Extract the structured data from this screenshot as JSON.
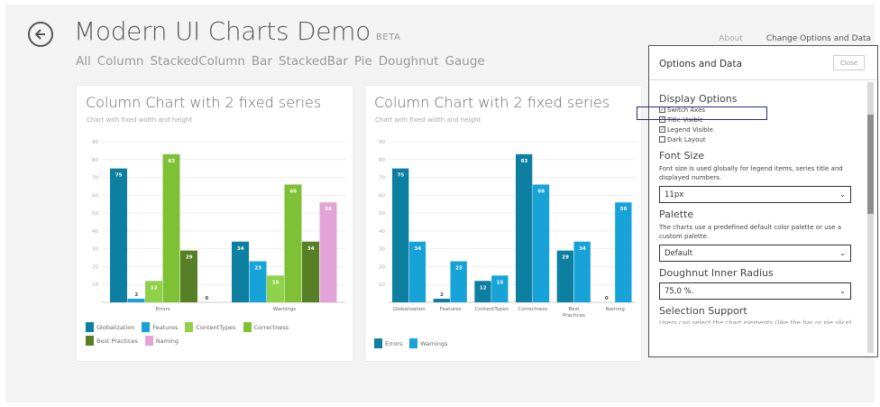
{
  "app": {
    "title": "Modern UI Charts Demo",
    "badge": "BETA",
    "nav": [
      "All",
      "Column",
      "StackedColumn",
      "Bar",
      "StackedBar",
      "Pie",
      "Doughnut",
      "Gauge"
    ],
    "top_links": {
      "about": "About",
      "options": "Change Options and Data"
    }
  },
  "colors": {
    "globalization": "#0d7fa1",
    "features": "#17a3d8",
    "content_types": "#8fd24a",
    "correctness": "#7fc135",
    "best_practices": "#577f25",
    "naming": "#e2a4d6",
    "errors": "#0d7fa1",
    "warnings": "#17a3d8"
  },
  "chart_data": [
    {
      "type": "bar",
      "title": "Column Chart with 2 fixed series",
      "subtitle": "Chart with fixed width and height",
      "categories": [
        "Errors",
        "Warnings"
      ],
      "ylim": [
        0,
        90
      ],
      "yticks": [
        10,
        20,
        30,
        40,
        50,
        60,
        70,
        80,
        90
      ],
      "series": [
        {
          "name": "Globalization",
          "values": [
            75,
            34
          ]
        },
        {
          "name": "Features",
          "values": [
            2,
            23
          ]
        },
        {
          "name": "ContentTypes",
          "values": [
            12,
            15
          ]
        },
        {
          "name": "Correctness",
          "values": [
            83,
            66
          ]
        },
        {
          "name": "Best Practices",
          "values": [
            29,
            34
          ]
        },
        {
          "name": "Naming",
          "values": [
            0,
            56
          ]
        }
      ]
    },
    {
      "type": "bar",
      "title": "Column Chart with 2 fixed series",
      "subtitle": "Chart with fixed width and height",
      "categories": [
        "Globalization",
        "Features",
        "ContentTypes",
        "Correctness",
        "Best Practices",
        "Naming"
      ],
      "ylim": [
        0,
        90
      ],
      "yticks": [
        10,
        20,
        30,
        40,
        50,
        60,
        70,
        80,
        90
      ],
      "series": [
        {
          "name": "Errors",
          "values": [
            75,
            2,
            12,
            83,
            29,
            0
          ]
        },
        {
          "name": "Warnings",
          "values": [
            34,
            23,
            15,
            66,
            34,
            56
          ]
        }
      ]
    }
  ],
  "panel": {
    "title": "Options and Data",
    "close": "Close",
    "display_options": "Display Options",
    "checkboxes": [
      {
        "label": "Switch Axes",
        "checked": true
      },
      {
        "label": "Title Visible",
        "checked": true
      },
      {
        "label": "Legend Visible",
        "checked": true
      },
      {
        "label": "Dark Layout",
        "checked": false
      }
    ],
    "font_size": {
      "title": "Font Size",
      "desc": "Font size is used globally for legend items, series title and displayed numbers.",
      "value": "11px"
    },
    "palette": {
      "title": "Palette",
      "desc": "The charts use a predefined default color palette or use a custom palette.",
      "value": "Default"
    },
    "doughnut": {
      "title": "Doughnut Inner Radius",
      "value": "75,0 %."
    },
    "selection": {
      "title": "Selection Support",
      "desc": "Users can select the chart elements (like the bar or pie slice)"
    }
  }
}
